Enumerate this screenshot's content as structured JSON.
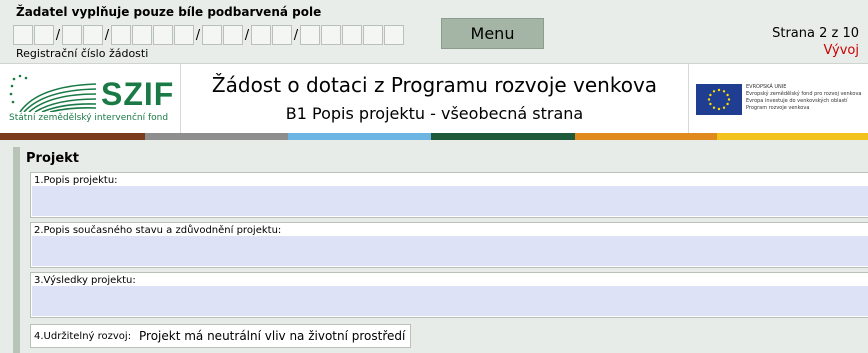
{
  "topbar": {
    "instruction": "Žadatel vyplňuje pouze bíle podbarvená pole",
    "registration_label": "Registrační číslo žádosti",
    "menu_label": "Menu",
    "page_indicator": "Strana 2 z 10",
    "mode": "Vývoj"
  },
  "header": {
    "logo_text": "SZIF",
    "logo_subtitle": "Státní zemědělský intervenční fond",
    "title": "Žádost o dotaci z Programu rozvoje venkova",
    "subtitle": "B1 Popis projektu - všeobecná strana",
    "eu_lines": [
      "EVROPSKÁ UNIE",
      "Evropský zemědělský fond pro rozvoj venkova",
      "Evropa investuje do venkovských oblastí",
      "Program rozvoje venkova"
    ]
  },
  "stripe_colors": [
    "#7b3c1e",
    "#8e8e8e",
    "#6cb4e2",
    "#1e5a3a",
    "#e08a1e",
    "#f2c21e"
  ],
  "section": {
    "title": "Projekt",
    "fields": [
      {
        "label": "1.Popis projektu:",
        "value": ""
      },
      {
        "label": "2.Popis současného stavu a zdůvodnění projektu:",
        "value": ""
      },
      {
        "label": "3.Výsledky projektu:",
        "value": ""
      }
    ],
    "sustainability": {
      "label": "4.Udržitelný rozvoj:",
      "value": "Projekt má neutrální vliv na životní prostředí"
    }
  }
}
